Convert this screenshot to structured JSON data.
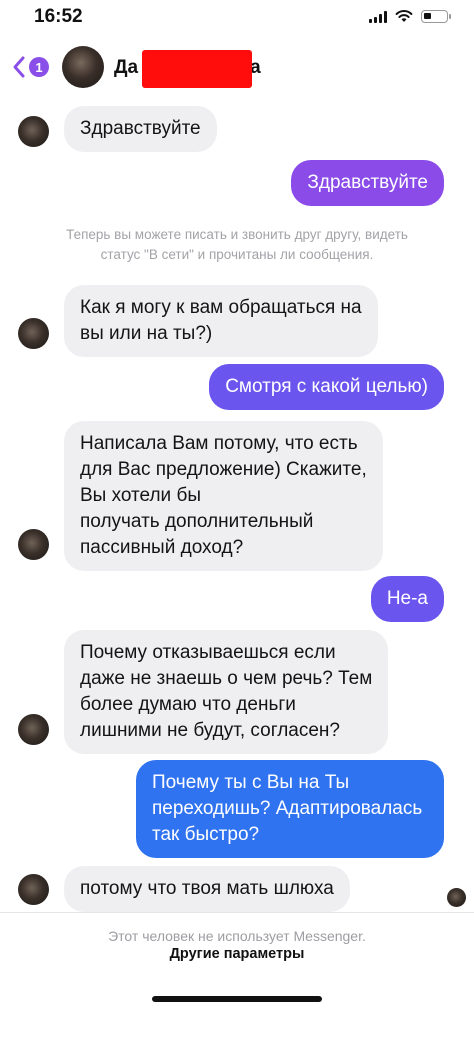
{
  "status_bar": {
    "time": "16:52",
    "icons": [
      "signal-icon",
      "wifi-icon",
      "battery-icon"
    ]
  },
  "header": {
    "back_badge_count": "1",
    "name_prefix": "Да",
    "name_suffix": "а",
    "name_redacted": true,
    "redaction_color": "#ff0d0d"
  },
  "conversation": {
    "msg_1": "Здравствуйте",
    "msg_2": "Здравствуйте",
    "system_notice": "Теперь вы можете писать и звонить друг другу, видеть\nстатус \"В сети\" и прочитаны ли сообщения.",
    "msg_3": "Как я могу к вам обращаться на\nвы или на ты?)",
    "msg_4": "Смотря с какой целью)",
    "msg_5": "Написала Вам потому, что есть\nдля Вас предложение) Скажите,\nВы хотели бы\nполучать дополнительный\nпассивный доход?",
    "msg_6": "Не-а",
    "msg_7": "Почему отказываешься если\nдаже не знаешь о чем речь? Тем\nболее думаю что деньги\nлишними не будут, согласен?",
    "msg_8": "Почему ты с Вы на Ты\nпереходишь? Адаптировалась\nтак быстро?",
    "msg_9": "потому что твоя мать шлюха"
  },
  "footer": {
    "notice": "Этот человек не использует Messenger.",
    "link": "Другие параметры"
  },
  "colors": {
    "incoming_bubble": "#efeff2",
    "outgoing_purple": "#8a4be9",
    "outgoing_blend": "#6a56ee",
    "outgoing_blue": "#2f73f0",
    "accent": "#8a4fe8"
  }
}
